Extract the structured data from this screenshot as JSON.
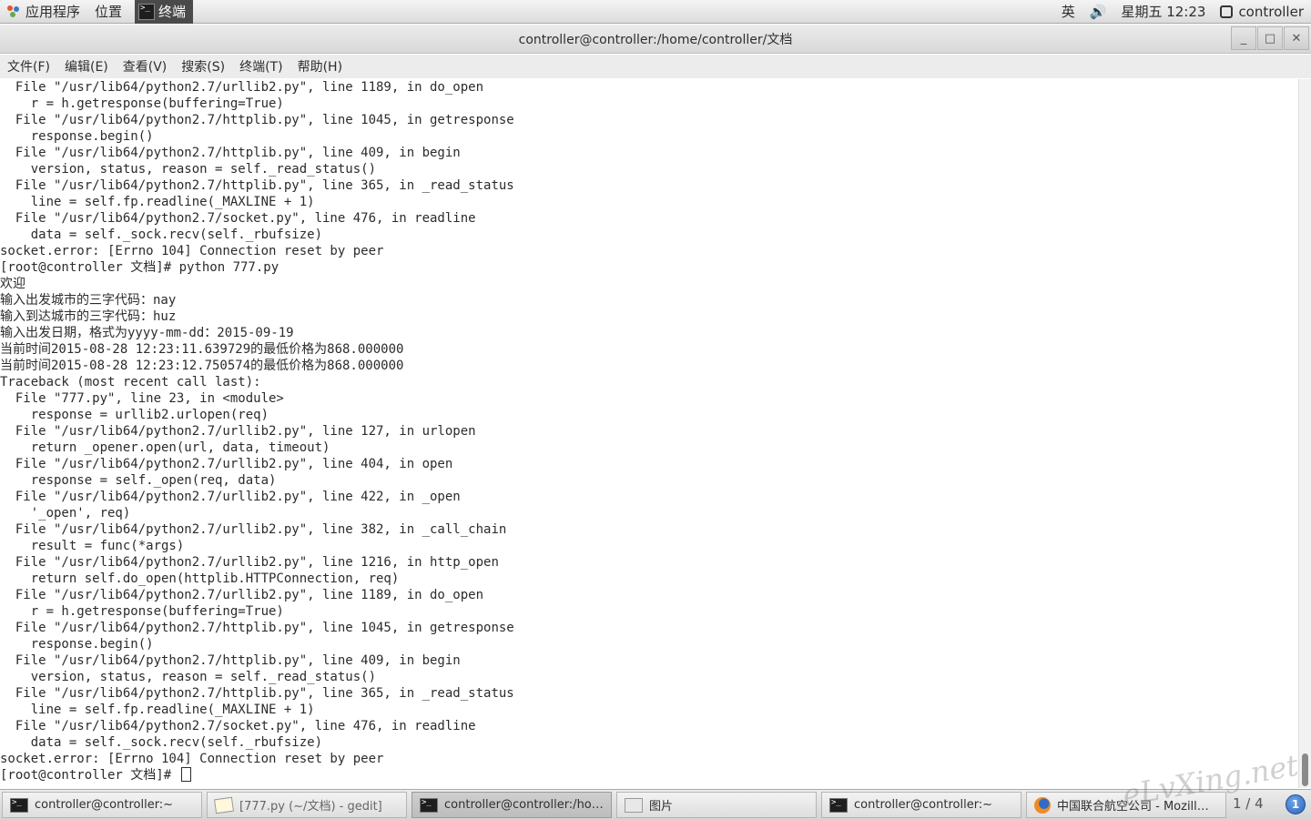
{
  "top_panel": {
    "applications": "应用程序",
    "places": "位置",
    "terminal_task": "终端",
    "input_method": "英",
    "datetime": "星期五 12:23",
    "user": "controller"
  },
  "window": {
    "title": "controller@controller:/home/controller/文档",
    "minimize": "_",
    "maximize": "□",
    "close": "✕"
  },
  "menu": [
    "文件(F)",
    "编辑(E)",
    "查看(V)",
    "搜索(S)",
    "终端(T)",
    "帮助(H)"
  ],
  "terminal": {
    "lines": [
      "  File \"/usr/lib64/python2.7/urllib2.py\", line 1189, in do_open",
      "    r = h.getresponse(buffering=True)",
      "  File \"/usr/lib64/python2.7/httplib.py\", line 1045, in getresponse",
      "    response.begin()",
      "  File \"/usr/lib64/python2.7/httplib.py\", line 409, in begin",
      "    version, status, reason = self._read_status()",
      "  File \"/usr/lib64/python2.7/httplib.py\", line 365, in _read_status",
      "    line = self.fp.readline(_MAXLINE + 1)",
      "  File \"/usr/lib64/python2.7/socket.py\", line 476, in readline",
      "    data = self._sock.recv(self._rbufsize)",
      "socket.error: [Errno 104] Connection reset by peer",
      "[root@controller 文档]# python 777.py",
      "欢迎",
      "输入出发城市的三字代码：nay",
      "输入到达城市的三字代码：huz",
      "输入出发日期，格式为yyyy-mm-dd：2015-09-19",
      "当前时间2015-08-28 12:23:11.639729的最低价格为868.000000",
      "当前时间2015-08-28 12:23:12.750574的最低价格为868.000000",
      "Traceback (most recent call last):",
      "  File \"777.py\", line 23, in <module>",
      "    response = urllib2.urlopen(req)",
      "  File \"/usr/lib64/python2.7/urllib2.py\", line 127, in urlopen",
      "    return _opener.open(url, data, timeout)",
      "  File \"/usr/lib64/python2.7/urllib2.py\", line 404, in open",
      "    response = self._open(req, data)",
      "  File \"/usr/lib64/python2.7/urllib2.py\", line 422, in _open",
      "    '_open', req)",
      "  File \"/usr/lib64/python2.7/urllib2.py\", line 382, in _call_chain",
      "    result = func(*args)",
      "  File \"/usr/lib64/python2.7/urllib2.py\", line 1216, in http_open",
      "    return self.do_open(httplib.HTTPConnection, req)",
      "  File \"/usr/lib64/python2.7/urllib2.py\", line 1189, in do_open",
      "    r = h.getresponse(buffering=True)",
      "  File \"/usr/lib64/python2.7/httplib.py\", line 1045, in getresponse",
      "    response.begin()",
      "  File \"/usr/lib64/python2.7/httplib.py\", line 409, in begin",
      "    version, status, reason = self._read_status()",
      "  File \"/usr/lib64/python2.7/httplib.py\", line 365, in _read_status",
      "    line = self.fp.readline(_MAXLINE + 1)",
      "  File \"/usr/lib64/python2.7/socket.py\", line 476, in readline",
      "    data = self._sock.recv(self._rbufsize)",
      "socket.error: [Errno 104] Connection reset by peer"
    ],
    "prompt": "[root@controller 文档]# "
  },
  "taskbar": {
    "tasks": [
      {
        "label": "controller@controller:~",
        "icon": "terminal-icon"
      },
      {
        "label": "[777.py (~/文档) - gedit]",
        "icon": "gedit-icon"
      },
      {
        "label": "controller@controller:/ho…",
        "icon": "terminal-icon"
      },
      {
        "label": "图片",
        "icon": "image-viewer-icon"
      },
      {
        "label": "controller@controller:~",
        "icon": "terminal-icon"
      },
      {
        "label": "中国联合航空公司 - Mozill…",
        "icon": "firefox-icon"
      }
    ],
    "workspace": "1 / 4",
    "notifications": "1"
  },
  "watermark": "eLvXing.net"
}
